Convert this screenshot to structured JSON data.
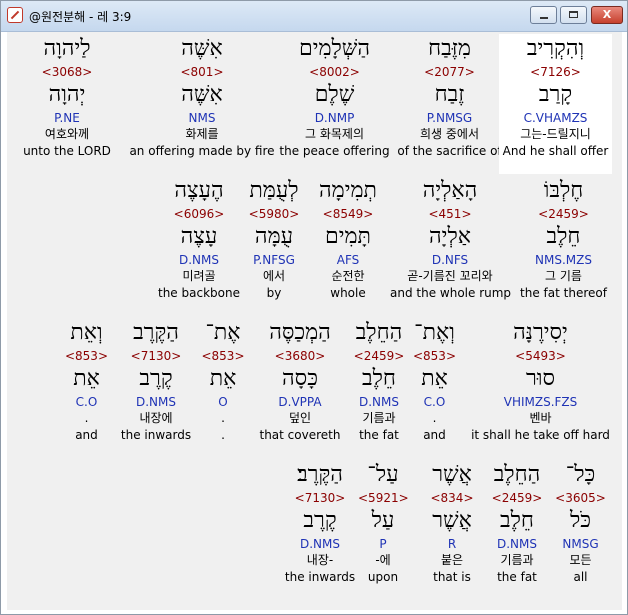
{
  "window": {
    "title": "@원전분해 - 레 3:9",
    "buttons": {
      "minimize": "",
      "maximize": "",
      "close": "X"
    }
  },
  "rows": [
    {
      "words": [
        {
          "heb": "לַיהוָה",
          "strong": "<3068>",
          "lemma": "יְהוָה",
          "morph": "P.NE",
          "kor": "여호와께",
          "eng": "unto the LORD"
        },
        {
          "heb": "אִשֶּׁה",
          "strong": "<801>",
          "lemma": "אִשֶּׁה",
          "morph": "NMS",
          "kor": "화제를",
          "eng": "an offering made by fire"
        },
        {
          "heb": "הַשְּׁלָמִים",
          "strong": "<8002>",
          "lemma": "שֶׁלֶם",
          "morph": "D.NMP",
          "kor": "그 화목제의",
          "eng": "the peace offering"
        },
        {
          "heb": "מִזֶּבַח",
          "strong": "<2077>",
          "lemma": "זֶבַח",
          "morph": "P.NMSG",
          "kor": "희생 중에서",
          "eng": "of the sacrifice of"
        },
        {
          "heb": "וְהִקְרִיב",
          "strong": "<7126>",
          "lemma": "קָרַב",
          "morph": "C.VHAMZS",
          "kor": "그는-드릴지니",
          "eng": "And he shall offer"
        }
      ]
    },
    {
      "words": [
        {
          "heb": "הֶעָצֶה",
          "strong": "<6096>",
          "lemma": "עָצֶה",
          "morph": "D.NMS",
          "kor": "미려골",
          "eng": "the backbone"
        },
        {
          "heb": "לְעֻמַּת",
          "strong": "<5980>",
          "lemma": "עֻמָּה",
          "morph": "P.NFSG",
          "kor": "에서",
          "eng": "by"
        },
        {
          "heb": "תְמִימָה",
          "strong": "<8549>",
          "lemma": "תָּמִים",
          "morph": "AFS",
          "kor": "순전한",
          "eng": "whole"
        },
        {
          "heb": "הָאַלְיָה",
          "strong": "<451>",
          "lemma": "אַלְיָה",
          "morph": "D.NFS",
          "kor": "곧-기름진 꼬리와",
          "eng": "and the whole rump"
        },
        {
          "heb": "חֶלְבּוֹ",
          "strong": "<2459>",
          "lemma": "חֵלֶב",
          "morph": "NMS.MZS",
          "kor": "그 기름",
          "eng": "the fat thereof"
        }
      ]
    },
    {
      "words": [
        {
          "heb": "וְאֵת",
          "strong": "<853>",
          "lemma": "אֵת",
          "morph": "C.O",
          "kor": ".",
          "eng": "and"
        },
        {
          "heb": "הַקֶּרֶב",
          "strong": "<7130>",
          "lemma": "קֶרֶב",
          "morph": "D.NMS",
          "kor": "내장에",
          "eng": "the inwards"
        },
        {
          "heb": "אֶת־",
          "strong": "<853>",
          "lemma": "אֵת",
          "morph": "O",
          "kor": ".",
          "eng": "."
        },
        {
          "heb": "הַמְכַסֶּה",
          "strong": "<3680>",
          "lemma": "כָּסָה",
          "morph": "D.VPPA",
          "kor": "덮인",
          "eng": "that covereth"
        },
        {
          "heb": "הַחֵלֶב",
          "strong": "<2459>",
          "lemma": "חֵלֶב",
          "morph": "D.NMS",
          "kor": "기름과",
          "eng": "the fat"
        },
        {
          "heb": "וְאֶת־",
          "strong": "<853>",
          "lemma": "אֵת",
          "morph": "C.O",
          "kor": ".",
          "eng": "and"
        },
        {
          "heb": "יְסִירֶנָּה",
          "strong": "<5493>",
          "lemma": "סוּר",
          "morph": "VHIMZS.FZS",
          "kor": "벤바",
          "eng": "it shall he take off hard"
        }
      ]
    },
    {
      "words": [
        {
          "heb": "הַקֶּרֶב׃",
          "strong": "<7130>",
          "lemma": "קֶרֶב",
          "morph": "D.NMS",
          "kor": "내장-",
          "eng": "the inwards"
        },
        {
          "heb": "עַל־",
          "strong": "<5921>",
          "lemma": "עַל",
          "morph": "P",
          "kor": "-에",
          "eng": "upon"
        },
        {
          "heb": "אֲשֶׁר",
          "strong": "<834>",
          "lemma": "אֲשֶׁר",
          "morph": "R",
          "kor": "붙은",
          "eng": "that is"
        },
        {
          "heb": "הַחֵלֶב",
          "strong": "<2459>",
          "lemma": "חֵלֶב",
          "morph": "D.NMS",
          "kor": "기름과",
          "eng": "the fat"
        },
        {
          "heb": "כָּל־",
          "strong": "<3605>",
          "lemma": "כֹּל",
          "morph": "NMSG",
          "kor": "모든",
          "eng": "all"
        }
      ]
    }
  ]
}
